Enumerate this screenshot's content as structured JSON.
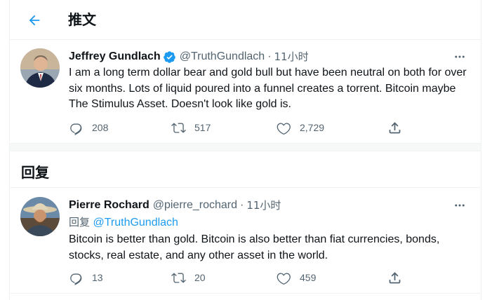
{
  "header": {
    "title": "推文",
    "back_icon": "arrow-left-icon"
  },
  "colors": {
    "accent": "#1d9bf0",
    "secondary_text": "#536471",
    "primary_text": "#0f1419"
  },
  "main_tweet": {
    "author_name": "Jeffrey Gundlach",
    "verified": true,
    "handle": "@TruthGundlach",
    "separator": "·",
    "time": "11小时",
    "text": "I am a long term dollar bear and gold bull but have been neutral on both for over six months. Lots of liquid poured into a funnel creates a torrent. Bitcoin maybe The Stimulus Asset. Doesn't look like gold is.",
    "stats": {
      "replies": "208",
      "retweets": "517",
      "likes": "2,729"
    }
  },
  "replies_section": {
    "title": "回复"
  },
  "reply_tweet": {
    "author_name": "Pierre Rochard",
    "handle": "@pierre_rochard",
    "separator": "·",
    "time": "11小时",
    "replying_label": "回复",
    "replying_to": "@TruthGundlach",
    "text": "Bitcoin is better than gold. Bitcoin is also better than fiat currencies, bonds, stocks, real estate, and any other asset in the world.",
    "stats": {
      "replies": "13",
      "retweets": "20",
      "likes": "459"
    }
  }
}
